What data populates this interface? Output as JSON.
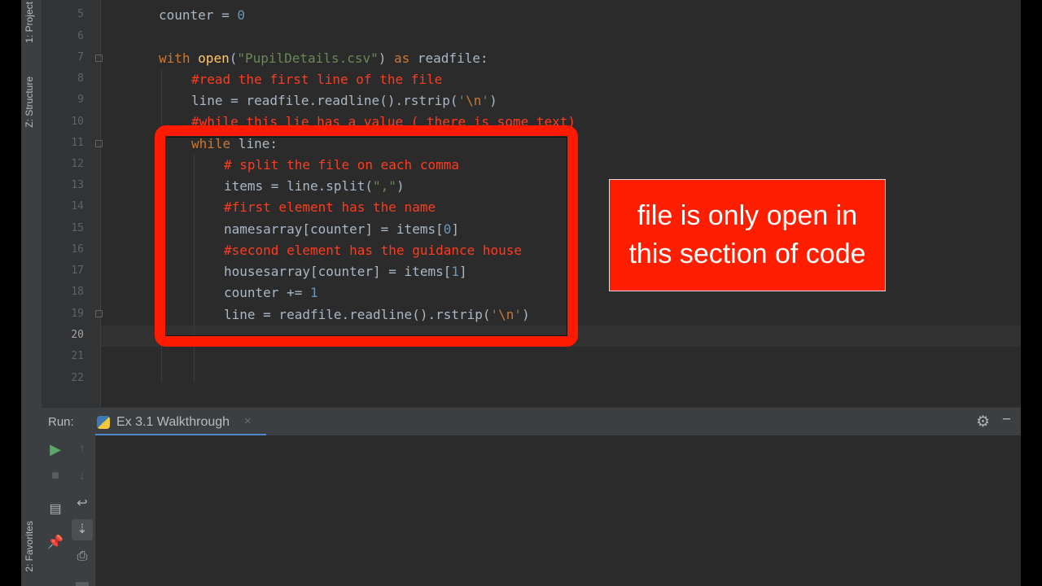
{
  "side_tabs": {
    "project": "1: Project",
    "structure": "Z: Structure",
    "favorites": "2: Favorites"
  },
  "editor": {
    "line_numbers": [
      "5",
      "6",
      "7",
      "8",
      "9",
      "10",
      "11",
      "12",
      "13",
      "14",
      "15",
      "16",
      "17",
      "18",
      "19",
      "20",
      "21",
      "22"
    ],
    "current_line": "20",
    "lines": {
      "l5": {
        "a": "counter = ",
        "b": "0"
      },
      "l7": {
        "kw": "with ",
        "fn": "open",
        "p1": "(",
        "str": "\"PupilDetails.csv\"",
        "p2": ") ",
        "kw2": "as",
        "rest": " readfile:"
      },
      "l8": {
        "cm": "#read the first line of the file"
      },
      "l9": {
        "a": "line = readfile.readline().rstrip(",
        "str1": "'",
        "esc": "\\n",
        "str2": "'",
        "b": ")"
      },
      "l10": {
        "cm": "#while this lie has a value ( there is some text)"
      },
      "l11": {
        "kw": "while",
        "rest": " line:"
      },
      "l12": {
        "cm": "# split the file on each comma"
      },
      "l13": {
        "a": "items = line.split(",
        "str": "\",\"",
        "b": ")"
      },
      "l14": {
        "cm": "#first element has the name"
      },
      "l15": {
        "a": "namesarray[counter] = items[",
        "num": "0",
        "b": "]"
      },
      "l16": {
        "cm": "#second element has the guidance house"
      },
      "l17": {
        "a": "housesarray[counter] = items[",
        "num": "1",
        "b": "]"
      },
      "l18": {
        "a": "counter += ",
        "num": "1"
      },
      "l19": {
        "a": "line = readfile.readline().rstrip(",
        "str1": "'",
        "esc": "\\n",
        "str2": "'",
        "b": ")"
      }
    }
  },
  "annotation": {
    "text": "file is only open in this section of code"
  },
  "run_panel": {
    "label": "Run:",
    "tab_label": "Ex 3.1 Walkthrough",
    "close_glyph": "×"
  },
  "colors": {
    "highlight": "#ff1a00",
    "annotation_bg": "#ff1f00",
    "keyword": "#cc7832",
    "comment": "#ff3b1f"
  }
}
